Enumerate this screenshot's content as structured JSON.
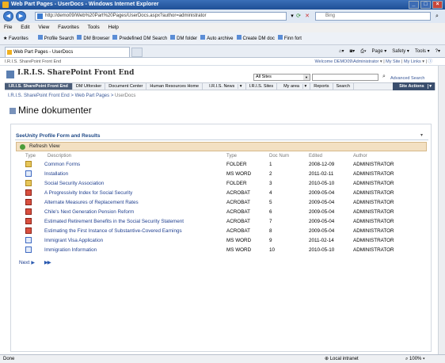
{
  "window": {
    "title": "Web Part Pages - UserDocs - Windows Internet Explorer"
  },
  "address": {
    "url": "http://demo09/Web%20Part%20Pages/UserDocs.aspx?author=administrator"
  },
  "search": {
    "placeholder": "Bing"
  },
  "menu": [
    "File",
    "Edit",
    "View",
    "Favorites",
    "Tools",
    "Help"
  ],
  "favorites": {
    "label": "Favorites",
    "items": [
      "Profile Search",
      "DM Browser",
      "Predefined DM Search",
      "DM folder",
      "Auto archive",
      "Create DM doc",
      "Finn fort"
    ]
  },
  "tab": {
    "label": "Web Part Pages - UserDocs"
  },
  "commandbar": [
    "Page",
    "Safety",
    "Tools"
  ],
  "sp": {
    "top_left": "I.R.I.S. SharePoint Front End",
    "welcome": "Welcome DEMO09\\Administrator",
    "my_site": "My Site",
    "my_links": "My Links",
    "site_title": "I.R.I.S. SharePoint Front End",
    "scope": "All Sites",
    "advanced_search": "Advanced Search",
    "nav": [
      "I.R.I.S. SharePoint Front End",
      "DM Utforsker",
      "Document Center",
      "Human Resources Home",
      "I.R.I.S. News",
      "I.R.I.S. Sites",
      "My area",
      "Reports",
      "Search"
    ],
    "site_actions": "Site Actions",
    "breadcrumb": [
      "I.R.I.S. SharePoint Front End",
      "Web Part Pages",
      "UserDocs"
    ],
    "page_title": "Mine dokumenter"
  },
  "webpart": {
    "title": "SeeUnity Profile Form and Results",
    "refresh": "Refresh View",
    "columns": [
      "Type",
      "Description",
      "Type",
      "Doc Num",
      "Edited",
      "Author"
    ],
    "rows": [
      {
        "icon": "folder",
        "description": "Common Forms",
        "type": "FOLDER",
        "docnum": "1",
        "edited": "2008-12-09",
        "author": "ADMINISTRATOR"
      },
      {
        "icon": "word",
        "description": "Installation",
        "type": "MS WORD",
        "docnum": "2",
        "edited": "2011-02-11",
        "author": "ADMINISTRATOR"
      },
      {
        "icon": "folder",
        "description": "Social Security Association",
        "type": "FOLDER",
        "docnum": "3",
        "edited": "2010-05-10",
        "author": "ADMINISTRATOR"
      },
      {
        "icon": "acrobat",
        "description": "A Progressivity Index for Social Security",
        "type": "ACROBAT",
        "docnum": "4",
        "edited": "2009-05-04",
        "author": "ADMINISTRATOR"
      },
      {
        "icon": "acrobat",
        "description": "Alternate Measures of Replacement Rates",
        "type": "ACROBAT",
        "docnum": "5",
        "edited": "2009-05-04",
        "author": "ADMINISTRATOR"
      },
      {
        "icon": "acrobat",
        "description": "Chile's Next Generation Pension Reform",
        "type": "ACROBAT",
        "docnum": "6",
        "edited": "2009-05-04",
        "author": "ADMINISTRATOR"
      },
      {
        "icon": "acrobat",
        "description": "Estimated Retirement Benefits in the Social Security Statement",
        "type": "ACROBAT",
        "docnum": "7",
        "edited": "2009-05-04",
        "author": "ADMINISTRATOR"
      },
      {
        "icon": "acrobat",
        "description": "Estimating the First Instance of Substantive-Covered Earnings",
        "type": "ACROBAT",
        "docnum": "8",
        "edited": "2009-05-04",
        "author": "ADMINISTRATOR"
      },
      {
        "icon": "word",
        "description": "Immigrant Visa Application",
        "type": "MS WORD",
        "docnum": "9",
        "edited": "2011-02-14",
        "author": "ADMINISTRATOR"
      },
      {
        "icon": "word",
        "description": "Immigration Information",
        "type": "MS WORD",
        "docnum": "10",
        "edited": "2010-05-10",
        "author": "ADMINISTRATOR"
      }
    ],
    "next": "Next"
  },
  "status": {
    "left": "Done",
    "zone": "Local intranet",
    "zoom": "100%"
  }
}
